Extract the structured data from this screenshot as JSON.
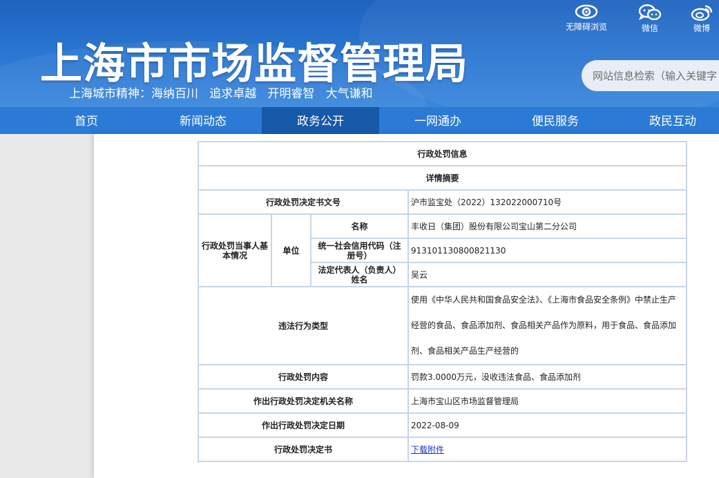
{
  "header": {
    "site_title": "上海市市场监督管理局",
    "motto": "上海城市精神：海纳百川   追求卓越   开明睿智   大气谦和",
    "tools": {
      "accessible": "无障碍浏览",
      "wechat": "微信",
      "weibo": "微博"
    },
    "search": {
      "placeholder": "网站信息检索（输入关键字"
    }
  },
  "nav": {
    "items": [
      "首页",
      "新闻动态",
      "政务公开",
      "一网通办",
      "便民服务",
      "政民互动"
    ],
    "active": "政务公开"
  },
  "table": {
    "title": "行政处罚信息",
    "subtitle": "详情摘要",
    "doc_no_label": "行政处罚决定书文号",
    "doc_no": "沪市监宝处（2022）132022000710号",
    "party_label": "行政处罚当事人基本情况",
    "unit_label": "单位",
    "name_label": "名称",
    "name": "丰收日（集团）股份有限公司宝山第二分公司",
    "credit_code_label": "统一社会信用代码（注册号）",
    "credit_code": "913101130800821130",
    "legal_rep_label": "法定代表人（负责人）姓名",
    "legal_rep": "吴云",
    "violation_type_label": "违法行为类型",
    "violation_type": "使用《中华人民共和国食品安全法》、《上海市食品安全条例》中禁止生产经营的食品、食品添加剂、食品相关产品作为原料，用于食品、食品添加剂、食品相关产品生产经营的",
    "penalty_content_label": "行政处罚内容",
    "penalty_content": "罚款3.0000万元，没收违法食品、食品添加剂",
    "authority_label": "作出行政处罚决定机关名称",
    "authority": "上海市宝山区市场监督管理局",
    "decision_date_label": "作出行政处罚决定日期",
    "decision_date": "2022-08-09",
    "decision_doc_label": "行政处罚决定书",
    "decision_doc_link": "下载附件"
  },
  "colors": {
    "header_blue": "#2b78d2",
    "nav_blue": "#2a7ad6",
    "nav_active": "#1659a9",
    "table_border": "#c6d6e5",
    "link": "#1a33c8"
  },
  "icons": [
    "eye-icon",
    "wechat-icon",
    "weibo-icon"
  ]
}
